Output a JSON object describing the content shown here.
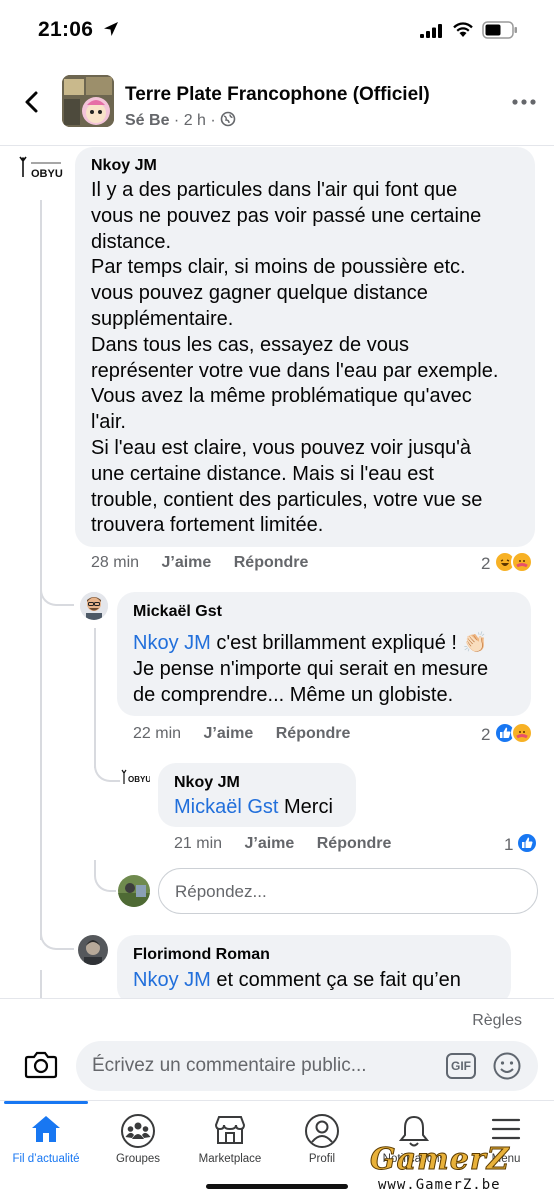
{
  "status_bar": {
    "time": "21:06"
  },
  "header": {
    "title": "Terre Plate Francophone (Officiel)",
    "author": "Sé Be",
    "time": "· 2 h ·"
  },
  "comments": [
    {
      "name": "Nkoy JM",
      "lines": [
        "Il y a des particules dans l'air qui font que",
        "vous ne pouvez pas voir passé une certaine",
        "distance.",
        "Par temps clair, si moins de poussière etc.",
        "vous pouvez gagner quelque distance",
        "supplémentaire.",
        "Dans tous les cas, essayez de vous",
        "représenter votre vue dans l'eau par exemple.",
        "Vous avez la même problématique qu'avec",
        "l'air.",
        "Si l'eau est claire, vous pouvez voir jusqu'à",
        "une certaine distance. Mais si l'eau est",
        "trouble, contient des particules, votre vue se",
        "trouvera fortement limitée."
      ],
      "time": "28 min",
      "like_label": "J’aime",
      "reply_label": "Répondre",
      "reaction_count": "2",
      "reactions": [
        "haha",
        "care"
      ]
    },
    {
      "name": "Mickaël Gst",
      "mention": "Nkoy JM",
      "lines": [
        " c'est brillamment expliqué ! 👏🏻",
        "Je pense n'importe qui serait en mesure",
        "de comprendre... Même un globiste."
      ],
      "time": "22 min",
      "like_label": "J’aime",
      "reply_label": "Répondre",
      "reaction_count": "2",
      "reactions": [
        "like",
        "care"
      ]
    },
    {
      "name": "Nkoy JM",
      "mention": "Mickaël Gst",
      "text": " Merci",
      "time": "21 min",
      "like_label": "J’aime",
      "reply_label": "Répondre",
      "reaction_count": "1",
      "reactions": [
        "like"
      ]
    },
    {
      "name": "Florimond Roman",
      "mention": "Nkoy JM",
      "text": " et comment ça se fait qu’en"
    }
  ],
  "reply_input": {
    "placeholder": "Répondez..."
  },
  "compose": {
    "rules_label": "Règles",
    "placeholder": "Écrivez un commentaire public...",
    "gif_label": "GIF"
  },
  "tabs": [
    {
      "label": "Fil d’actualité",
      "icon": "home-icon",
      "active": true
    },
    {
      "label": "Groupes",
      "icon": "groups-icon"
    },
    {
      "label": "Marketplace",
      "icon": "marketplace-icon"
    },
    {
      "label": "Profil",
      "icon": "profile-icon"
    },
    {
      "label": "Notifications",
      "icon": "bell-icon"
    },
    {
      "label": "Menu",
      "icon": "menu-icon"
    }
  ],
  "avatar_logo_text": "OBYU",
  "watermark": {
    "logo_text": "GamerZ",
    "url": "www.GamerZ.be"
  },
  "colors": {
    "accent": "#1877f2",
    "mention": "#216fdb",
    "bubble": "#f0f2f5",
    "secondary_text": "#65676b"
  }
}
